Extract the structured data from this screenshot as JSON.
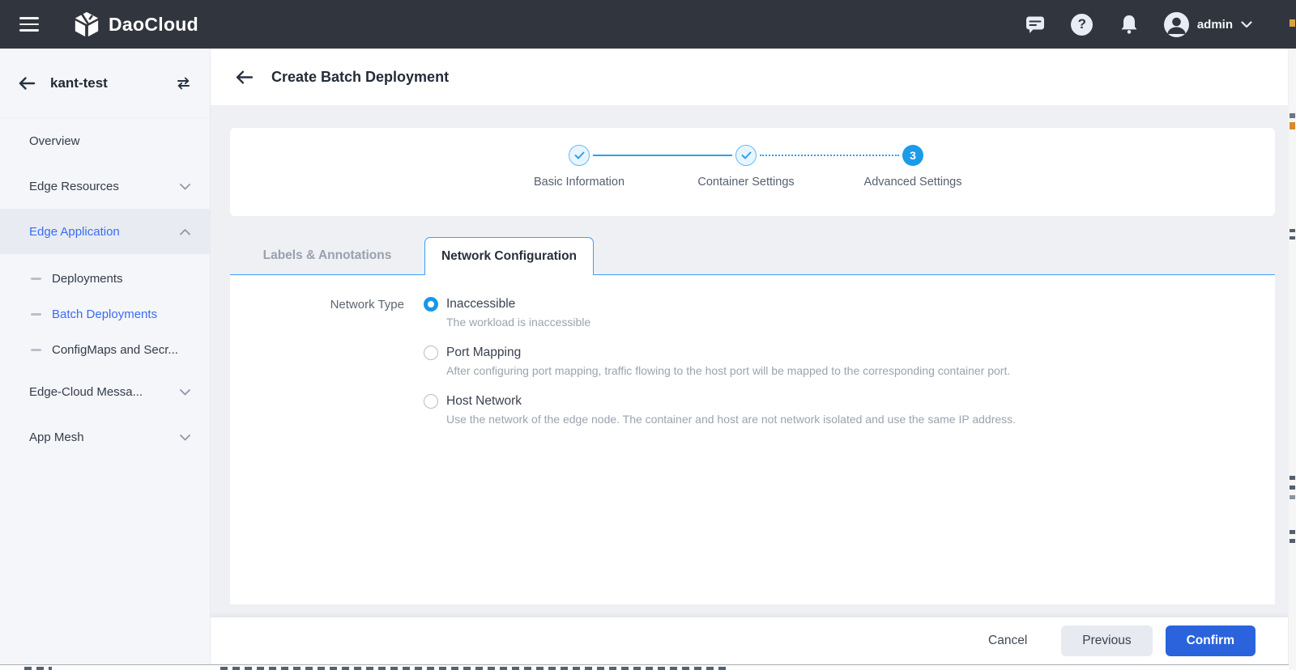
{
  "topbar": {
    "brand": "DaoCloud",
    "help_glyph": "?",
    "user": {
      "name": "admin"
    }
  },
  "sidebar": {
    "title": "kant-test",
    "items": [
      {
        "label": "Overview",
        "type": "item"
      },
      {
        "label": "Edge Resources",
        "type": "group",
        "chevron": "down"
      },
      {
        "label": "Edge Application",
        "type": "group",
        "chevron": "up",
        "active": true
      },
      {
        "label": "Deployments",
        "type": "subitem",
        "active": false
      },
      {
        "label": "Batch Deployments",
        "type": "subitem",
        "active": true
      },
      {
        "label": "ConfigMaps and Secr...",
        "type": "subitem",
        "active": false
      },
      {
        "label": "Edge-Cloud Messa...",
        "type": "group",
        "chevron": "down"
      },
      {
        "label": "App Mesh",
        "type": "group",
        "chevron": "down"
      }
    ]
  },
  "page": {
    "title": "Create Batch Deployment"
  },
  "stepper": {
    "steps": [
      {
        "label": "Basic Information",
        "state": "done"
      },
      {
        "label": "Container Settings",
        "state": "done"
      },
      {
        "label": "Advanced Settings",
        "state": "current",
        "number": "3"
      }
    ]
  },
  "tabs": [
    {
      "label": "Labels & Annotations",
      "active": false
    },
    {
      "label": "Network Configuration",
      "active": true
    }
  ],
  "form": {
    "network_type_label": "Network Type",
    "options": [
      {
        "label": "Inaccessible",
        "desc": "The workload is inaccessible",
        "selected": true
      },
      {
        "label": "Port Mapping",
        "desc": "After configuring port mapping, traffic flowing to the host port will be mapped to the corresponding container port.",
        "selected": false
      },
      {
        "label": "Host Network",
        "desc": "Use the network of the edge node. The container and host are not network isolated and use the same IP address.",
        "selected": false
      }
    ]
  },
  "footer": {
    "cancel_label": "Cancel",
    "previous_label": "Previous",
    "confirm_label": "Confirm"
  },
  "colors": {
    "topbar_bg": "#31363e",
    "sidebar_bg": "#f5f6fa",
    "content_bg": "#eef0f4",
    "accent_link_blue": "#3a6cf3",
    "stepper_azure": "#1b9be9",
    "tab_border_blue": "#3e9ef7",
    "radio_selected_blue": "#1897e9",
    "confirm_button_blue": "#2a63dc"
  }
}
